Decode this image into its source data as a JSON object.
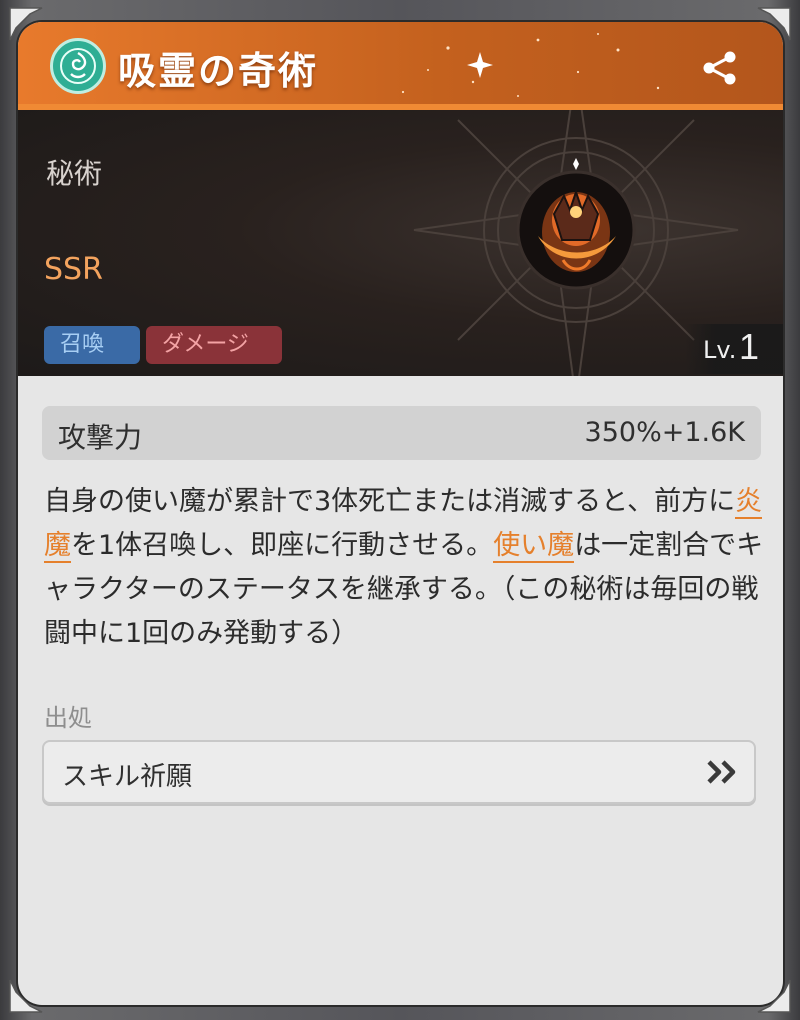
{
  "header": {
    "title": "吸霊の奇術",
    "emblem_icon": "rune-emblem-icon",
    "share_icon": "share-icon"
  },
  "banner": {
    "category": "秘術",
    "rarity": "SSR",
    "tags": [
      "召喚",
      "ダメージ"
    ],
    "level_prefix": "Lv.",
    "level": "1",
    "skill_icon": "flame-demon-hand-icon"
  },
  "stat": {
    "label": "攻撃力",
    "value": "350%+1.6K"
  },
  "description": {
    "part1": "自身の使い魔が累計で3体死亡または消滅すると、前方に",
    "keyword1": "炎魔",
    "part2": "を1体召喚し、即座に行動させる。",
    "keyword2": "使い魔",
    "part3": "は一定割合でキャラクターのステータスを継承する。（この秘術は毎回の戦闘中に1回のみ発動する）"
  },
  "source": {
    "label": "出処",
    "button_text": "スキル祈願",
    "arrow_icon": "double-chevron-right-icon"
  },
  "colors": {
    "header_orange": "#e87a2c",
    "highlight": "#e5802c",
    "rarity": "#f3a35e",
    "tag_summon": "#3a6aa6",
    "tag_damage": "#8a3339",
    "emblem": "#2fae94"
  }
}
